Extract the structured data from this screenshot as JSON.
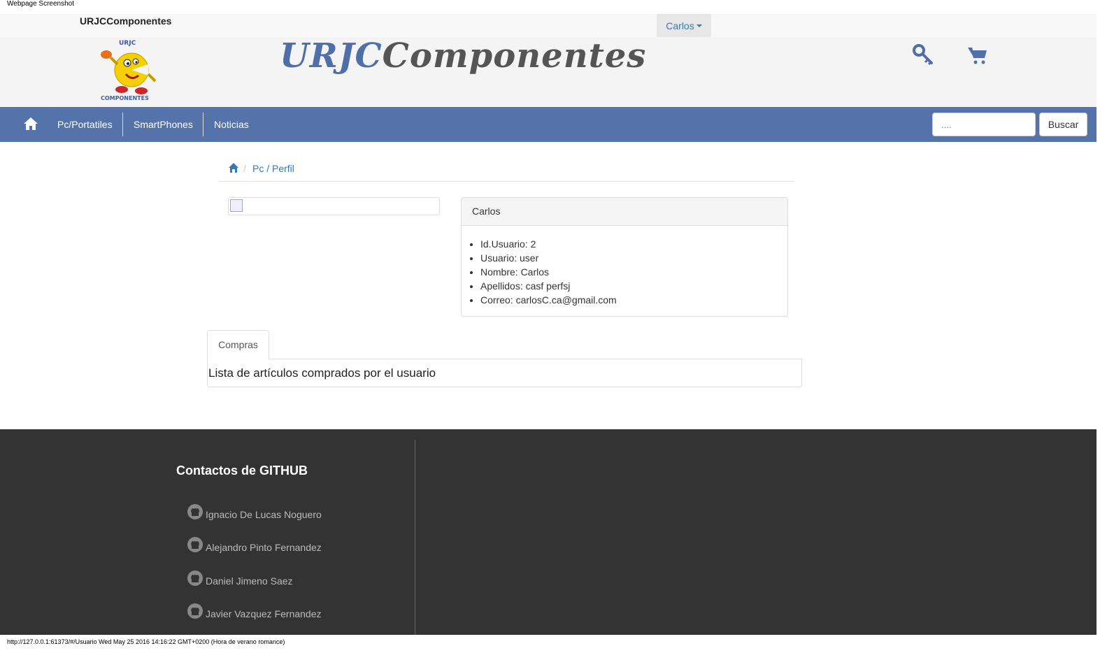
{
  "caption": "Webpage Screenshot",
  "topbar": {
    "brand": "URJCComponentes",
    "user_menu": "Carlos"
  },
  "banner": {
    "title_part1": "URJC",
    "title_part2": "Componentes",
    "logo_text": "URJC COMPONENTES"
  },
  "nav": {
    "items": [
      {
        "label": "Pc/Portatiles"
      },
      {
        "label": "SmartPhones"
      },
      {
        "label": "Noticias"
      }
    ],
    "search_placeholder": "....",
    "search_button": "Buscar"
  },
  "breadcrumb": {
    "sep": "/",
    "path": "Pc / Perfil"
  },
  "profile": {
    "heading": "Carlos",
    "fields": [
      "Id.Usuario: 2",
      "Usuario: user",
      "Nombre: Carlos",
      "Apellidos: casf perfsj",
      "Correo: carlosC.ca@gmail.com"
    ]
  },
  "tabs": {
    "active": "Compras",
    "content": "Lista de artículos comprados por el usuario"
  },
  "footer": {
    "title": "Contactos de GITHUB",
    "contacts": [
      "Ignacio De Lucas Noguero",
      "Alejandro Pinto Fernandez",
      "Daniel Jimeno Saez",
      "Javier Vazquez Fernandez"
    ]
  },
  "statusbar": "http://127.0.0.1:61373/#/Usuario Wed May 25 2016 14:16:22 GMT+0200 (Hora de verano romance)",
  "colors": {
    "navbar": "#5473aa",
    "accent": "#337ab7",
    "footer": "#333333"
  }
}
